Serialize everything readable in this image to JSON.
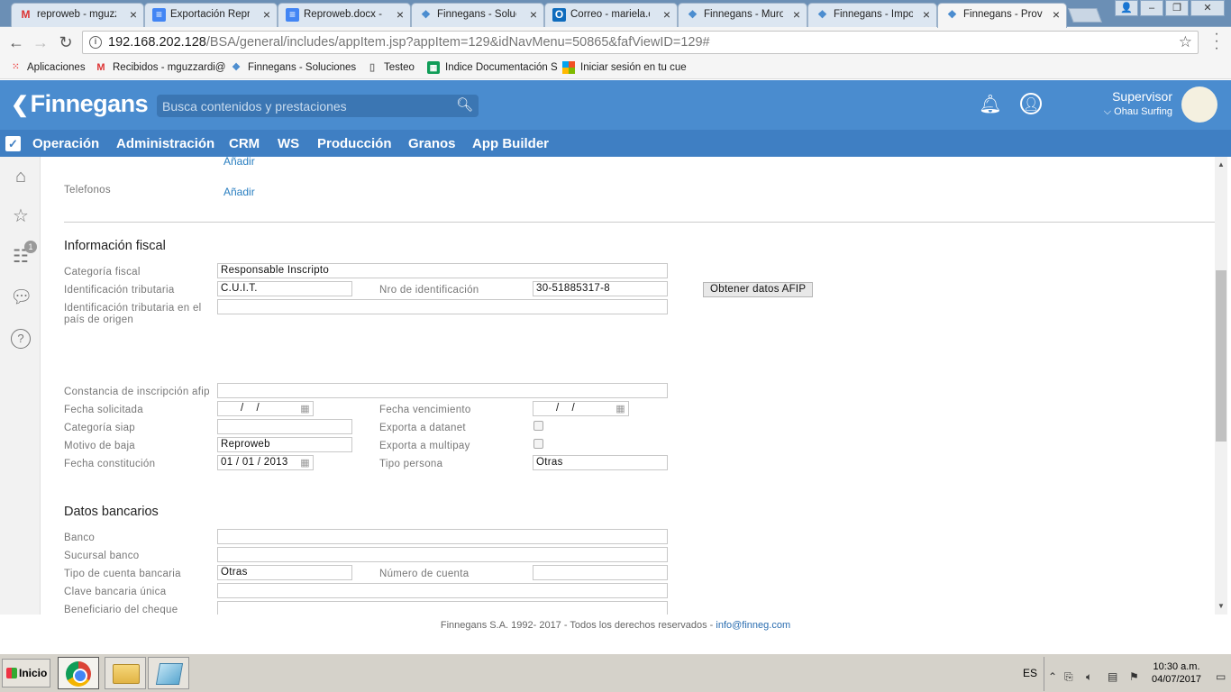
{
  "browser": {
    "tabs": [
      {
        "label": "reproweb - mguzz",
        "icon": "gmail-icon"
      },
      {
        "label": "Exportación Repro",
        "icon": "docs-icon"
      },
      {
        "label": "Reproweb.docx -",
        "icon": "docs-icon"
      },
      {
        "label": "Finnegans - Soluc",
        "icon": "finnegans-icon"
      },
      {
        "label": "Correo - mariela.c",
        "icon": "outlook-icon"
      },
      {
        "label": "Finnegans - Muro",
        "icon": "finnegans-icon"
      },
      {
        "label": "Finnegans - Impo",
        "icon": "finnegans-icon"
      },
      {
        "label": "Finnegans - Prove",
        "icon": "finnegans-icon"
      }
    ],
    "url_host": "192.168.202.128",
    "url_path": "/BSA/general/includes/appItem.jsp?appItem=129&idNavMenu=50865&fafViewID=129#",
    "bookmarks": [
      {
        "label": "Aplicaciones",
        "icon": "apps-grid-icon"
      },
      {
        "label": "Recibidos - mguzzardi@",
        "icon": "gmail-icon"
      },
      {
        "label": "Finnegans - Soluciones",
        "icon": "finnegans-icon"
      },
      {
        "label": "Testeo",
        "icon": "page-icon"
      },
      {
        "label": "Indice Documentación S",
        "icon": "sheets-icon"
      },
      {
        "label": "Iniciar sesión en tu cue",
        "icon": "microsoft-icon"
      }
    ]
  },
  "app": {
    "logo": "Finnegans",
    "search_placeholder": "Busca contenidos y prestaciones",
    "user_name": "Supervisor",
    "user_org": "Ohau Surfing",
    "menu": [
      "Operación",
      "Administración",
      "CRM",
      "WS",
      "Producción",
      "Granos",
      "App Builder"
    ],
    "sidebar_badge": "1"
  },
  "form": {
    "top_link": "Añadir",
    "telefonos_label": "Telefonos",
    "telefonos_link": "Añadir",
    "fiscal": {
      "title": "Información fiscal",
      "categoria_fiscal_label": "Categoría fiscal",
      "categoria_fiscal_value": "Responsable Inscripto",
      "id_tributaria_label": "Identificación tributaria",
      "id_tributaria_value": "C.U.I.T.",
      "nro_id_label": "Nro de identificación",
      "nro_id_value": "30-51885317-8",
      "afip_button": "Obtener datos AFIP",
      "id_origen_label_1": "Identificación tributaria en el",
      "id_origen_label_2": "país de origen",
      "constancia_label": "Constancia de inscripción afip",
      "fecha_solicitada_label": "Fecha solicitada",
      "fecha_solicitada_value": "  /    /",
      "fecha_vencimiento_label": "Fecha vencimiento",
      "fecha_vencimiento_value": "  /    /",
      "categoria_siap_label": "Categoría siap",
      "exporta_datanet_label": "Exporta a datanet",
      "motivo_baja_label": "Motivo de baja",
      "motivo_baja_value": "Reproweb",
      "exporta_multipay_label": "Exporta a multipay",
      "fecha_constitucion_label": "Fecha constitución",
      "fecha_constitucion_value": "01 / 01 / 2013",
      "tipo_persona_label": "Tipo persona",
      "tipo_persona_value": "Otras"
    },
    "bancarios": {
      "title": "Datos bancarios",
      "banco_label": "Banco",
      "sucursal_label": "Sucursal banco",
      "tipo_cuenta_label": "Tipo de cuenta bancaria",
      "tipo_cuenta_value": "Otras",
      "numero_cuenta_label": "Número de cuenta",
      "cbu_label": "Clave bancaria única",
      "beneficiario_label": "Beneficiario del cheque"
    }
  },
  "footer": {
    "text": "Finnegans S.A. 1992- 2017 - Todos los derechos reservados - ",
    "email": "info@finneg.com"
  },
  "taskbar": {
    "start": "Inicio",
    "lang": "ES",
    "time": "10:30 a.m.",
    "date": "04/07/2017"
  }
}
